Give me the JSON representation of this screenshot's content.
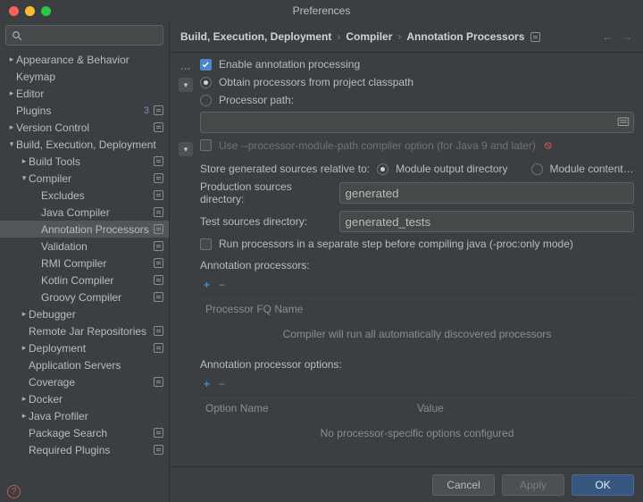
{
  "window": {
    "title": "Preferences"
  },
  "sidebar": {
    "search_placeholder": "",
    "items": [
      {
        "label": "Appearance & Behavior",
        "depth": 0,
        "arrow": "right",
        "badge": false
      },
      {
        "label": "Keymap",
        "depth": 0,
        "arrow": "none",
        "badge": false
      },
      {
        "label": "Editor",
        "depth": 0,
        "arrow": "right",
        "badge": false
      },
      {
        "label": "Plugins",
        "depth": 0,
        "arrow": "none",
        "badge": true,
        "count": "3"
      },
      {
        "label": "Version Control",
        "depth": 0,
        "arrow": "right",
        "badge": true
      },
      {
        "label": "Build, Execution, Deployment",
        "depth": 0,
        "arrow": "down",
        "badge": false
      },
      {
        "label": "Build Tools",
        "depth": 1,
        "arrow": "right",
        "badge": true
      },
      {
        "label": "Compiler",
        "depth": 1,
        "arrow": "down",
        "badge": true
      },
      {
        "label": "Excludes",
        "depth": 2,
        "arrow": "none",
        "badge": true
      },
      {
        "label": "Java Compiler",
        "depth": 2,
        "arrow": "none",
        "badge": true
      },
      {
        "label": "Annotation Processors",
        "depth": 2,
        "arrow": "none",
        "badge": true,
        "selected": true
      },
      {
        "label": "Validation",
        "depth": 2,
        "arrow": "none",
        "badge": true
      },
      {
        "label": "RMI Compiler",
        "depth": 2,
        "arrow": "none",
        "badge": true
      },
      {
        "label": "Kotlin Compiler",
        "depth": 2,
        "arrow": "none",
        "badge": true
      },
      {
        "label": "Groovy Compiler",
        "depth": 2,
        "arrow": "none",
        "badge": true
      },
      {
        "label": "Debugger",
        "depth": 1,
        "arrow": "right",
        "badge": false
      },
      {
        "label": "Remote Jar Repositories",
        "depth": 1,
        "arrow": "none",
        "badge": true
      },
      {
        "label": "Deployment",
        "depth": 1,
        "arrow": "right",
        "badge": true
      },
      {
        "label": "Application Servers",
        "depth": 1,
        "arrow": "none",
        "badge": false
      },
      {
        "label": "Coverage",
        "depth": 1,
        "arrow": "none",
        "badge": true
      },
      {
        "label": "Docker",
        "depth": 1,
        "arrow": "right",
        "badge": false
      },
      {
        "label": "Java Profiler",
        "depth": 1,
        "arrow": "right",
        "badge": false
      },
      {
        "label": "Package Search",
        "depth": 1,
        "arrow": "none",
        "badge": true
      },
      {
        "label": "Required Plugins",
        "depth": 1,
        "arrow": "none",
        "badge": true
      }
    ]
  },
  "breadcrumb": {
    "a": "Build, Execution, Deployment",
    "b": "Compiler",
    "c": "Annotation Processors"
  },
  "form": {
    "enable_label": "Enable annotation processing",
    "obtain_label": "Obtain processors from project classpath",
    "procpath_label": "Processor path:",
    "procpath_value": "",
    "modulepath_label": "Use --processor-module-path compiler option (for Java 9 and later)",
    "store_label": "Store generated sources relative to:",
    "store_opt1": "Module output directory",
    "store_opt2": "Module content…",
    "prod_label": "Production sources directory:",
    "prod_value": "generated",
    "test_label": "Test sources directory:",
    "test_value": "generated_tests",
    "separate_label": "Run processors in a separate step before compiling java (-proc:only mode)",
    "ap_section": "Annotation processors:",
    "ap_header": "Processor FQ Name",
    "ap_empty": "Compiler will run all automatically discovered processors",
    "opt_section": "Annotation processor options:",
    "opt_h1": "Option Name",
    "opt_h2": "Value",
    "opt_empty": "No processor-specific options configured"
  },
  "footer": {
    "cancel": "Cancel",
    "apply": "Apply",
    "ok": "OK"
  }
}
